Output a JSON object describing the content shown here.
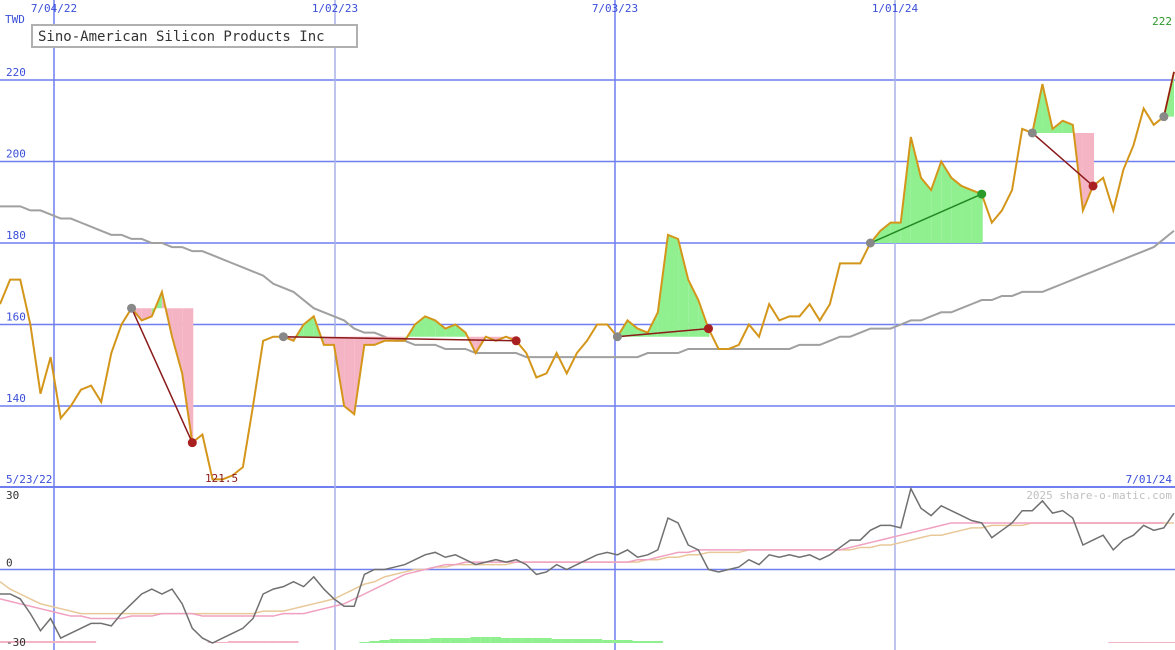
{
  "chart_data": {
    "type": "line",
    "title": "Sino-American Silicon Products Inc",
    "currency": "TWD",
    "copyright": "2025 share-o-matic.com",
    "start_date": "5/23/22",
    "end_date": "7/01/24",
    "x_date_labels": [
      "7/04/22",
      "1/02/23",
      "7/03/23",
      "1/01/24"
    ],
    "ylim": [
      120,
      222
    ],
    "yticks": [
      140,
      160,
      180,
      200,
      220
    ],
    "low_label": "121.5",
    "last_label": "222",
    "colors": {
      "price": "#d4961a",
      "moving_average": "#a0a0a0",
      "gain_fill": "#90f090",
      "loss_fill": "#f4b4c4",
      "gain_marker": "#2a9a2a",
      "loss_marker": "#a82020",
      "start_marker": "#888888",
      "grid": "#6f7fef",
      "indicator": "#707070",
      "indicator_fast": "#f0a0c0",
      "indicator_slow": "#e8c898"
    },
    "price_series": [
      165,
      171,
      171,
      160,
      143,
      152,
      137,
      140,
      144,
      145,
      141,
      153,
      160,
      164,
      161,
      162,
      168,
      157,
      148,
      131,
      133,
      122,
      122,
      123,
      125,
      140,
      156,
      157,
      157,
      156,
      160,
      162,
      155,
      155,
      140,
      138,
      155,
      155,
      156,
      156,
      156,
      160,
      162,
      161,
      159,
      160,
      158,
      153,
      157,
      156,
      157,
      156,
      153,
      147,
      148,
      153,
      148,
      153,
      156,
      160,
      160,
      157,
      161,
      159,
      158,
      163,
      182,
      181,
      171,
      166,
      159,
      154,
      154,
      155,
      160,
      157,
      165,
      161,
      162,
      162,
      165,
      161,
      165,
      175,
      175,
      175,
      180,
      183,
      185,
      185,
      206,
      196,
      193,
      200,
      196,
      194,
      193,
      192,
      185,
      188,
      193,
      208,
      207,
      219,
      208,
      210,
      209,
      188,
      194,
      196,
      188,
      198,
      204,
      213,
      209,
      211,
      222
    ],
    "moving_average_series": [
      189,
      189,
      189,
      188,
      188,
      187,
      186,
      186,
      185,
      184,
      183,
      182,
      182,
      181,
      181,
      180,
      180,
      179,
      179,
      178,
      178,
      177,
      176,
      175,
      174,
      173,
      172,
      170,
      169,
      168,
      166,
      164,
      163,
      162,
      161,
      159,
      158,
      158,
      157,
      156,
      156,
      155,
      155,
      155,
      154,
      154,
      154,
      153,
      153,
      153,
      153,
      153,
      152,
      152,
      152,
      152,
      152,
      152,
      152,
      152,
      152,
      152,
      152,
      152,
      153,
      153,
      153,
      153,
      154,
      154,
      154,
      154,
      154,
      154,
      154,
      154,
      154,
      154,
      154,
      155,
      155,
      155,
      156,
      157,
      157,
      158,
      159,
      159,
      159,
      160,
      161,
      161,
      162,
      163,
      163,
      164,
      165,
      166,
      166,
      167,
      167,
      168,
      168,
      168,
      169,
      170,
      171,
      172,
      173,
      174,
      175,
      176,
      177,
      178,
      179,
      181,
      183
    ],
    "trades": [
      {
        "start": 13,
        "end": 19,
        "result": "loss"
      },
      {
        "start": 28,
        "end": 51,
        "result": "loss"
      },
      {
        "start": 61,
        "end": 70,
        "result": "loss"
      },
      {
        "start": 86,
        "end": 97,
        "result": "gain"
      },
      {
        "start": 102,
        "end": 108,
        "result": "loss"
      },
      {
        "start": 115,
        "end": 116,
        "result": "open"
      }
    ],
    "indicator": {
      "ylim": [
        -30,
        30
      ],
      "yticks": [
        30,
        0,
        -30
      ],
      "main_series": [
        -10,
        -10,
        -12,
        -18,
        -25,
        -20,
        -28,
        -26,
        -24,
        -22,
        -22,
        -23,
        -18,
        -14,
        -10,
        -8,
        -10,
        -8,
        -14,
        -24,
        -28,
        -30,
        -28,
        -26,
        -24,
        -20,
        -10,
        -8,
        -7,
        -5,
        -7,
        -3,
        -8,
        -12,
        -15,
        -15,
        -2,
        0,
        0,
        1,
        2,
        4,
        6,
        7,
        5,
        6,
        4,
        2,
        3,
        4,
        3,
        4,
        2,
        -2,
        -1,
        2,
        0,
        2,
        4,
        6,
        7,
        6,
        8,
        5,
        6,
        8,
        21,
        19,
        10,
        8,
        0,
        -1,
        0,
        1,
        4,
        2,
        6,
        5,
        6,
        5,
        6,
        4,
        6,
        9,
        12,
        12,
        16,
        18,
        18,
        17,
        33,
        25,
        22,
        26,
        24,
        22,
        20,
        19,
        13,
        16,
        19,
        24,
        24,
        28,
        23,
        24,
        21,
        10,
        12,
        14,
        8,
        12,
        14,
        18,
        16,
        17,
        23
      ],
      "fast_series": [
        -12,
        -13,
        -14,
        -15,
        -16,
        -17,
        -18,
        -19,
        -19,
        -20,
        -20,
        -20,
        -20,
        -19,
        -19,
        -19,
        -18,
        -18,
        -18,
        -18,
        -19,
        -19,
        -19,
        -19,
        -19,
        -19,
        -19,
        -19,
        -18,
        -18,
        -18,
        -17,
        -16,
        -15,
        -14,
        -12,
        -10,
        -8,
        -6,
        -4,
        -2,
        -1,
        0,
        1,
        2,
        2,
        3,
        3,
        3,
        3,
        3,
        3,
        3,
        3,
        3,
        3,
        3,
        3,
        3,
        3,
        3,
        3,
        3,
        4,
        4,
        5,
        6,
        7,
        7,
        8,
        8,
        8,
        8,
        8,
        8,
        8,
        8,
        8,
        8,
        8,
        8,
        8,
        8,
        8,
        9,
        10,
        11,
        12,
        13,
        14,
        15,
        16,
        17,
        18,
        19,
        19,
        19,
        19,
        19,
        19,
        19,
        19,
        19,
        19,
        19,
        19,
        19,
        19,
        19,
        19,
        19,
        19,
        19,
        19,
        19,
        19
      ],
      "slow_series": [
        -5,
        -8,
        -10,
        -12,
        -14,
        -15,
        -16,
        -17,
        -18,
        -18,
        -18,
        -18,
        -18,
        -18,
        -18,
        -18,
        -18,
        -18,
        -18,
        -18,
        -18,
        -18,
        -18,
        -18,
        -18,
        -18,
        -17,
        -17,
        -17,
        -16,
        -15,
        -14,
        -13,
        -12,
        -10,
        -8,
        -6,
        -5,
        -3,
        -2,
        -1,
        0,
        0,
        1,
        1,
        2,
        2,
        2,
        2,
        2,
        2,
        3,
        3,
        3,
        3,
        3,
        3,
        3,
        3,
        3,
        3,
        3,
        3,
        3,
        4,
        4,
        5,
        5,
        6,
        6,
        7,
        7,
        7,
        7,
        8,
        8,
        8,
        8,
        8,
        8,
        8,
        8,
        8,
        8,
        8,
        9,
        9,
        10,
        10,
        11,
        12,
        13,
        14,
        14,
        15,
        16,
        17,
        17,
        18,
        18,
        18,
        18,
        19,
        19,
        19,
        19,
        19,
        19,
        19,
        19,
        19,
        19,
        19,
        19,
        19,
        19,
        19
      ],
      "bars": [
        -2,
        -2,
        -2,
        -2,
        -2,
        -2,
        -2,
        -2,
        -2,
        -2,
        0,
        0,
        0,
        0,
        0,
        0,
        0,
        0,
        0,
        0,
        0,
        -1,
        -1,
        -2,
        -2,
        -2,
        -2,
        -2,
        -2,
        -2,
        0,
        0,
        0,
        0,
        0,
        0,
        1,
        2,
        3,
        4,
        4,
        4,
        4,
        5,
        5,
        5,
        5,
        6,
        6,
        6,
        5,
        5,
        5,
        5,
        5,
        4,
        4,
        4,
        4,
        4,
        3,
        3,
        3,
        2,
        2,
        2,
        0,
        0,
        0,
        0,
        0,
        0,
        0,
        0,
        0,
        0,
        0,
        0,
        0,
        0,
        0,
        0,
        0,
        0,
        0,
        0,
        0,
        0,
        0,
        0,
        0,
        0,
        0,
        0,
        0,
        0,
        0,
        0,
        0,
        0,
        0,
        0,
        0,
        0,
        0,
        0,
        0,
        0,
        0,
        0,
        -1,
        -1,
        -1,
        -1,
        -1,
        -1,
        -1
      ]
    }
  }
}
